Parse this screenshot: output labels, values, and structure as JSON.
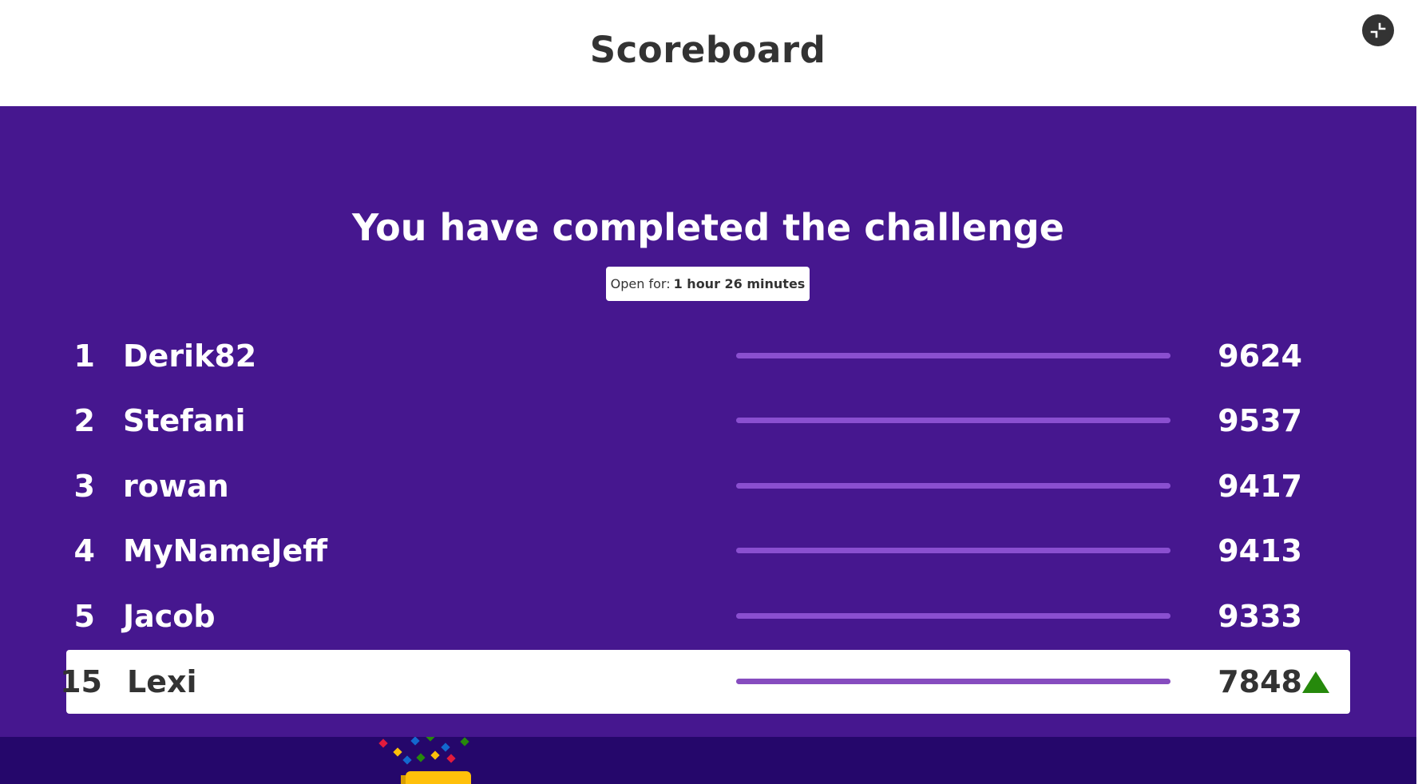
{
  "header": {
    "title": "Scoreboard",
    "fullscreen_icon": "fullscreen-exit-icon"
  },
  "main": {
    "headline": "You have completed the challenge",
    "timer": {
      "label": "Open for:",
      "value": "1 hour 26 minutes"
    }
  },
  "leaderboard": [
    {
      "rank": "1",
      "name": "Derik82",
      "score": "9624",
      "progress": 1.0
    },
    {
      "rank": "2",
      "name": "Stefani",
      "score": "9537",
      "progress": 1.0
    },
    {
      "rank": "3",
      "name": "rowan",
      "score": "9417",
      "progress": 1.0
    },
    {
      "rank": "4",
      "name": "MyNameJeff",
      "score": "9413",
      "progress": 1.0
    },
    {
      "rank": "5",
      "name": "Jacob",
      "score": "9333",
      "progress": 1.0
    }
  ],
  "current_player": {
    "rank": "15",
    "name": "Lexi",
    "score": "7848",
    "progress": 1.0,
    "trend_icon": "rank-up-arrow-icon"
  },
  "colors": {
    "brand_purple": "#46178f",
    "footer_purple": "#25076b",
    "bar_purple": "#8a4fd0",
    "trend_green": "#26890c",
    "podium_gold": "#ffc00a"
  }
}
